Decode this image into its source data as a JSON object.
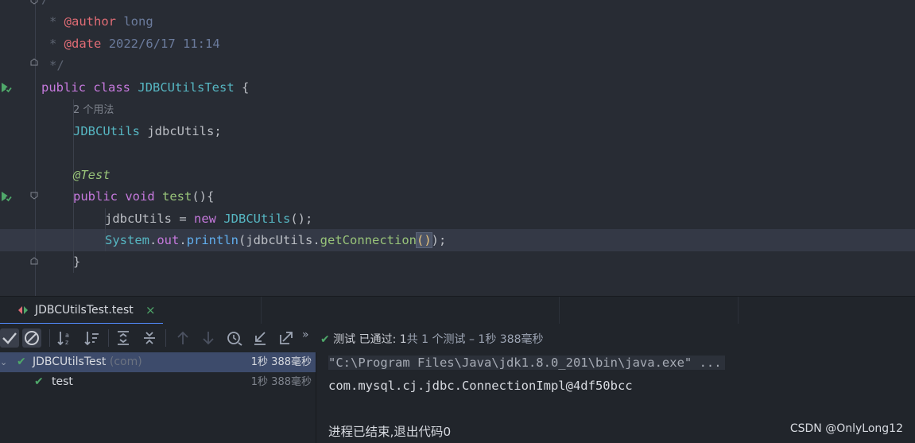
{
  "editor": {
    "comment_open": "/**",
    "author_tag": "@author",
    "author_value": "long",
    "date_tag": "@date",
    "date_value": "2022/6/17 11:14",
    "comment_close": "*/",
    "kw_public": "public",
    "kw_class": "class",
    "class_name": "JDBCUtilsTest",
    "brace_open": " {",
    "usage_hint": "2 个用法",
    "field_type": "JDBCUtils",
    "field_name": " jdbcUtils;",
    "annotation": "@Test",
    "kw_void": "void",
    "method_name": "test",
    "method_sig": "(){",
    "assign_lhs": "jdbcUtils = ",
    "kw_new": "new",
    "ctor": "JDBCUtils",
    "ctor_end": "();",
    "sys": "System",
    "dot1": ".",
    "out": "out",
    "dot2": ".",
    "println": "println",
    "call_open": "(jdbcUtils.",
    "getconn": "getConnection",
    "paren_pair": "()",
    "call_close": ");",
    "close_brace": "}"
  },
  "run_panel": {
    "tab_label": "JDBCUtilsTest.test",
    "tab_close": "×",
    "status_check": "✔",
    "status_passed": " 测试 已通过: 1",
    "status_rest": "共 1 个测试 – 1秒 388毫秒",
    "tree": [
      {
        "name": "JDBCUtilsTest",
        "pkg": " (com)",
        "time": "1秒 388毫秒"
      },
      {
        "name": "test",
        "pkg": "",
        "time": "1秒 388毫秒"
      }
    ],
    "console": [
      "\"C:\\Program Files\\Java\\jdk1.8.0_201\\bin\\java.exe\" ...",
      "com.mysql.cj.jdbc.ConnectionImpl@4df50bcc",
      "进程已结束,退出代码0"
    ],
    "watermark": "CSDN @OnlyLong12"
  },
  "colors": {
    "editor_bg": "#282c34",
    "panel_bg": "#21252b",
    "accent_green": "#4fa86a",
    "selection": "#3d4b6b"
  }
}
